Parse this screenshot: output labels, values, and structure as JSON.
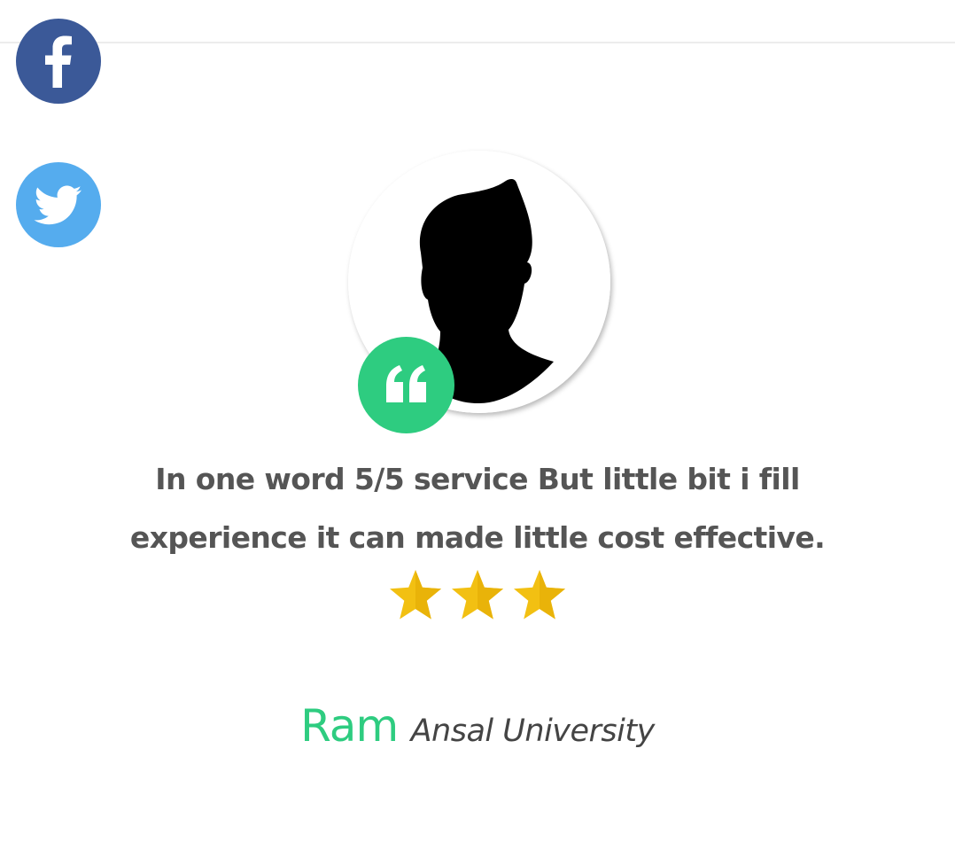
{
  "social": [
    {
      "icon": "facebook-icon",
      "color": "#3b5998"
    },
    {
      "icon": "twitter-icon",
      "color": "#55acee"
    }
  ],
  "testimonial": {
    "text": "In one word 5/5 service But little bit i fill experience it can made little cost effective.",
    "rating": 3,
    "author_name": "Ram",
    "author_org": "Ansal University"
  },
  "colors": {
    "accent": "#2ecc80",
    "star": "#f2c012",
    "text": "#555555"
  }
}
